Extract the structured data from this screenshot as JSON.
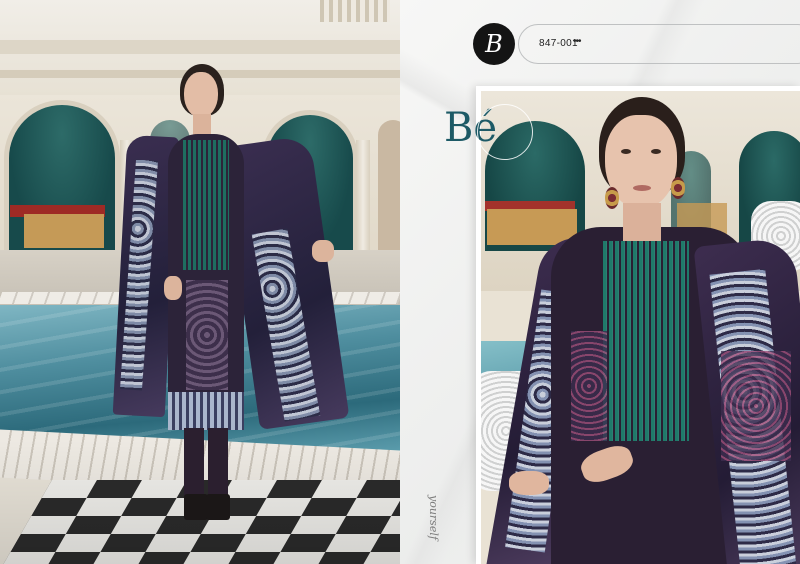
{
  "catalog": {
    "brand_logo_letter": "B",
    "design_code": "847-001",
    "wordmark": "Bé",
    "tagline": "yourself",
    "dots": "•••"
  },
  "colors": {
    "brand_teal": "#1d5a66",
    "logo_black": "#141414",
    "outfit_base": "#2a1f33",
    "embroidery_teal": "#1f7a6a",
    "pool_blue": "#3f8496"
  },
  "images": {
    "left_photo": "model-standing-poolside",
    "right_photo": "model-closeup-portrait"
  }
}
